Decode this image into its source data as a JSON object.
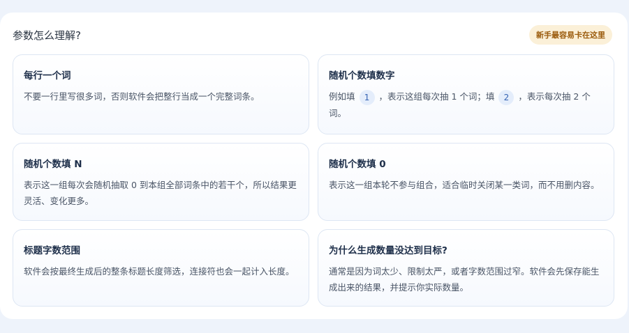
{
  "panel": {
    "title": "参数怎么理解?",
    "badge": "新手最容易卡在这里"
  },
  "cards": [
    {
      "title": "每行一个词",
      "text": "不要一行里写很多词，否则软件会把整行当成一个完整词条。"
    },
    {
      "title": "随机个数填数字",
      "text_before": "例如填",
      "chip1": "1",
      "text_middle": "，表示这组每次抽 1 个词；填",
      "chip2": "2",
      "text_after": "，表示每次抽 2 个词。"
    },
    {
      "title": "随机个数填 N",
      "text": "表示这一组每次会随机抽取 0 到本组全部词条中的若干个，所以结果更灵活、变化更多。"
    },
    {
      "title": "随机个数填 0",
      "text": "表示这一组本轮不参与组合，适合临时关闭某一类词，而不用删内容。"
    },
    {
      "title": "标题字数范围",
      "text": "软件会按最终生成后的整条标题长度筛选，连接符也会一起计入长度。"
    },
    {
      "title": "为什么生成数量没达到目标?",
      "text": "通常是因为词太少、限制太严，或者字数范围过窄。软件会先保存能生成出来的结果，并提示你实际数量。"
    }
  ]
}
